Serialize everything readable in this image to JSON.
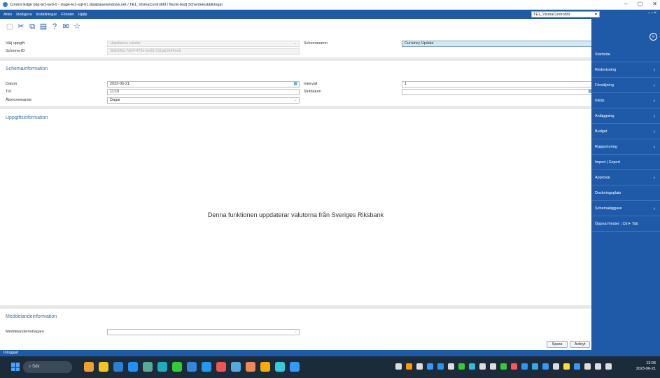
{
  "window": {
    "title": "Control Edge [stg-te1-avd-0 - stage-te1-sql-01.databasewindows.net / TE1_VismaControl99 / fkunk-test] Schemeinställningar",
    "controls": [
      "–",
      "▢",
      "✕"
    ]
  },
  "menubar": {
    "items": [
      "Arkiv",
      "Redigera",
      "Inställningar",
      "Fönster",
      "Hjälp"
    ],
    "company": "TE1_VismaControl99",
    "mdi_controls": "– ▫ ×"
  },
  "toolbar": {
    "icons": [
      "save-icon",
      "cut-icon",
      "copy-icon",
      "paste-icon",
      "help-icon",
      "comment-icon",
      "star-icon"
    ]
  },
  "form": {
    "valj_uppgift_label": "Välj uppgift",
    "valj_uppgift_value": "Uppdatera valutor",
    "schema_id_label": "Schema-ID",
    "schema_id_value": "f3d01f6a-7d04-476e-be69-211a61654ee5",
    "schemanamn_label": "Schemanamn",
    "schemanamn_value": "Currency Update"
  },
  "schemainfo": {
    "title": "Schemainformation",
    "datum_label": "Datum",
    "datum_value": "2023-06-21",
    "tid_label": "Tid",
    "tid_value": "11:15",
    "aterkommande_label": "Återkommande",
    "aterkommande_value": "Dagar",
    "intervall_label": "Intervall",
    "intervall_value": "1",
    "slutdatum_label": "Slutdatum",
    "slutdatum_value": ""
  },
  "uppgiftsinfo": {
    "title": "Uppgiftsinformation",
    "message": "Denna funktionen uppdaterar valutorna från Sveriges Riksbank"
  },
  "meddelande": {
    "title": "Meddelandeinformation",
    "mottagare_label": "Meddelandemottagare",
    "mottagare_value": ""
  },
  "buttons": {
    "save": "Spara",
    "cancel": "Avbryt"
  },
  "sidepanel": {
    "items": [
      {
        "label": "Startsida",
        "chevron": false
      },
      {
        "label": "Redovisning",
        "chevron": true
      },
      {
        "label": "Försäljning",
        "chevron": true
      },
      {
        "label": "Inköp",
        "chevron": true
      },
      {
        "label": "Anläggning",
        "chevron": true
      },
      {
        "label": "Budget",
        "chevron": true
      },
      {
        "label": "Rapportering",
        "chevron": true
      },
      {
        "label": "Import | Export",
        "chevron": false
      },
      {
        "label": "Approval",
        "chevron": true
      },
      {
        "label": "Dockningsplats",
        "chevron": false
      },
      {
        "label": "Schemaläggare",
        "chevron": true
      },
      {
        "label": "Öppna fönster ; Ctrl+ Tab",
        "chevron": false
      }
    ]
  },
  "statusbar": {
    "text": "Inloggad"
  },
  "taskbar": {
    "search": "Sök",
    "time": "13:06",
    "date": "2023-06-21",
    "app_colors": [
      "#f0a030",
      "#f5c518",
      "#2a7fd6",
      "#1e90ff",
      "#5a9",
      "#2ab",
      "#3c3",
      "#38d",
      "#29e",
      "#e55",
      "#5ad",
      "#e85",
      "#fa0",
      "#3cd",
      "#39f"
    ],
    "tray_colors": [
      "#ddd",
      "#f90",
      "#ddd",
      "#39f",
      "#29e",
      "#ddd",
      "#3c3",
      "#3bd",
      "#ddd",
      "#ddd",
      "#3c3",
      "#f55",
      "#29f",
      "#3ae",
      "#39f",
      "#ddd",
      "#fd3",
      "#39f",
      "#ddd",
      "#ddd",
      "#ddd"
    ]
  }
}
